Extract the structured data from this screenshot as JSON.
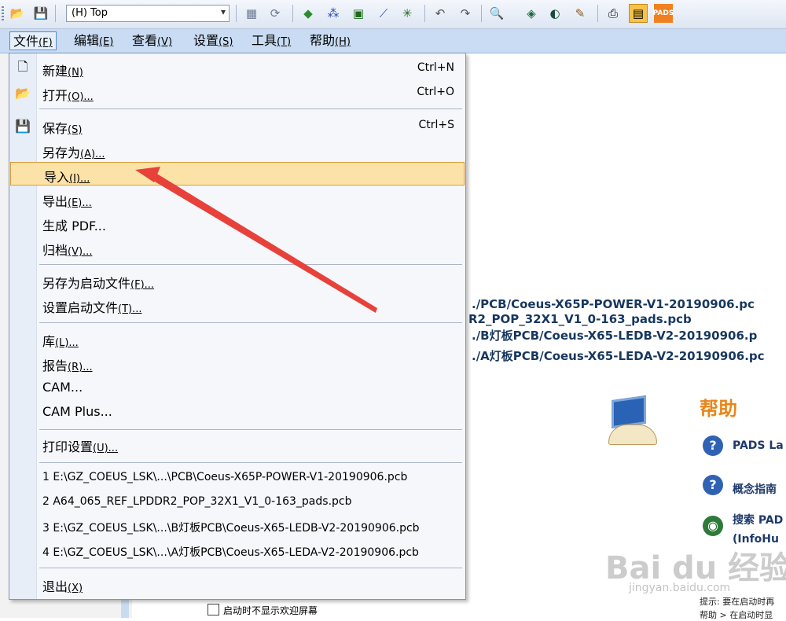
{
  "toolbar": {
    "layer_select": "(H) Top",
    "icons": [
      "open-folder-icon",
      "save-icon",
      "layer-combo",
      "properties-icon",
      "refresh-icon",
      "route-icon",
      "component-icon",
      "plane-icon",
      "trace-icon",
      "snap-icon",
      "undo-icon",
      "redo-icon",
      "zoom-icon",
      "view-icon",
      "mask-icon",
      "brush-icon",
      "print-icon",
      "highlight-icon",
      "pads-logo"
    ],
    "pads_label": "PADS"
  },
  "menubar": {
    "items": [
      {
        "label": "文件",
        "mnemonic": "(F)"
      },
      {
        "label": "编辑",
        "mnemonic": "(E)"
      },
      {
        "label": "查看",
        "mnemonic": "(V)"
      },
      {
        "label": "设置",
        "mnemonic": "(S)"
      },
      {
        "label": "工具",
        "mnemonic": "(T)"
      },
      {
        "label": "帮助",
        "mnemonic": "(H)"
      }
    ]
  },
  "file_menu": {
    "items": [
      {
        "label": "新建",
        "mnemonic": "(N)",
        "shortcut": "Ctrl+N",
        "icon": "new-file-icon"
      },
      {
        "label": "打开",
        "mnemonic": "(O)...",
        "shortcut": "Ctrl+O",
        "icon": "open-folder-icon"
      },
      {
        "label": "保存",
        "mnemonic": "(S)",
        "shortcut": "Ctrl+S",
        "icon": "save-icon"
      },
      {
        "label": "另存为",
        "mnemonic": "(A)..."
      },
      {
        "label": "导入",
        "mnemonic": "(I)..."
      },
      {
        "label": "导出",
        "mnemonic": "(E)..."
      },
      {
        "label": "生成 PDF..."
      },
      {
        "label": "归档",
        "mnemonic": "(V)..."
      },
      {
        "label": "另存为启动文件",
        "mnemonic": "(F)..."
      },
      {
        "label": "设置启动文件",
        "mnemonic": "(T)..."
      },
      {
        "label": "库",
        "mnemonic": "(L)..."
      },
      {
        "label": "报告",
        "mnemonic": "(R)..."
      },
      {
        "label": "CAM..."
      },
      {
        "label": "CAM Plus..."
      },
      {
        "label": "打印设置",
        "mnemonic": "(U)..."
      },
      {
        "label": "1 E:\\GZ_COEUS_LSK\\...\\PCB\\Coeus-X65P-POWER-V1-20190906.pcb"
      },
      {
        "label": "2 A64_065_REF_LPDDR2_POP_32X1_V1_0-163_pads.pcb"
      },
      {
        "label": "3 E:\\GZ_COEUS_LSK\\...\\B灯板PCB\\Coeus-X65-LEDB-V2-20190906.pcb"
      },
      {
        "label": "4 E:\\GZ_COEUS_LSK\\...\\A灯板PCB\\Coeus-X65-LEDA-V2-20190906.pcb"
      },
      {
        "label": "退出",
        "mnemonic": "(X)"
      }
    ],
    "highlighted": "导入"
  },
  "background": {
    "recent_links": [
      "./PCB/Coeus-X65P-POWER-V1-20190906.pc",
      "R2_POP_32X1_V1_0-163_pads.pcb",
      "./B灯板PCB/Coeus-X65-LEDB-V2-20190906.p",
      "./A灯板PCB/Coeus-X65-LEDA-V2-20190906.pc"
    ],
    "help_title": "帮助",
    "help_links": [
      "PADS La",
      "概念指南",
      "搜索 PAD",
      "(InfoHu"
    ],
    "tip_text": "提示: 要在启动时再",
    "help_path": "帮助 > 在启动时显",
    "startup_checkbox": "启动时不显示欢迎屏幕",
    "watermark": "Bai du 经验",
    "watermark_url": "jingyan.baidu.com"
  },
  "colors": {
    "accent": "#e8861a",
    "highlight": "#fbe3a8",
    "arrow": "#e8413a"
  }
}
